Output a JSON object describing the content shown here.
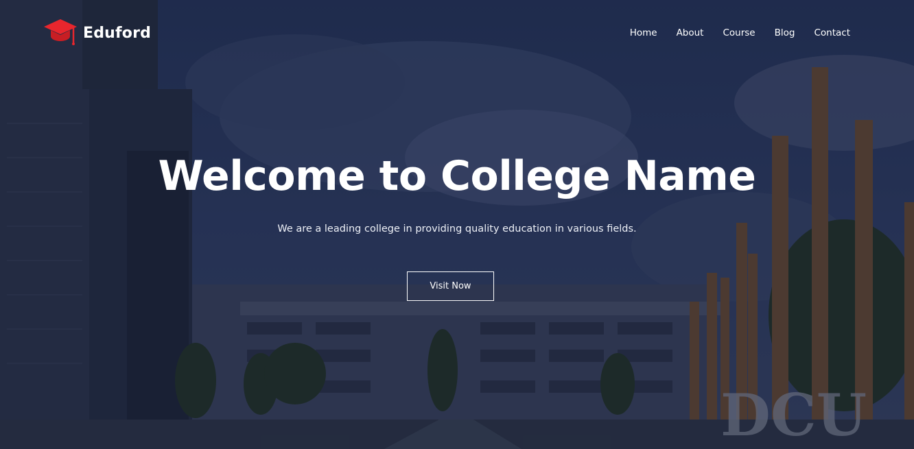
{
  "brand": {
    "name": "Eduford",
    "icon": "graduation-cap-icon",
    "icon_color": "#e8262d"
  },
  "nav": {
    "items": [
      {
        "label": "Home"
      },
      {
        "label": "About"
      },
      {
        "label": "Course"
      },
      {
        "label": "Blog"
      },
      {
        "label": "Contact"
      }
    ]
  },
  "hero": {
    "title": "Welcome to College Name",
    "subtitle": "We are a leading college in providing quality education in various fields.",
    "cta_label": "Visit Now",
    "sign_text": "DCU"
  },
  "colors": {
    "text": "#ffffff",
    "overlay": "#1e2a44",
    "accent": "#e8262d"
  }
}
